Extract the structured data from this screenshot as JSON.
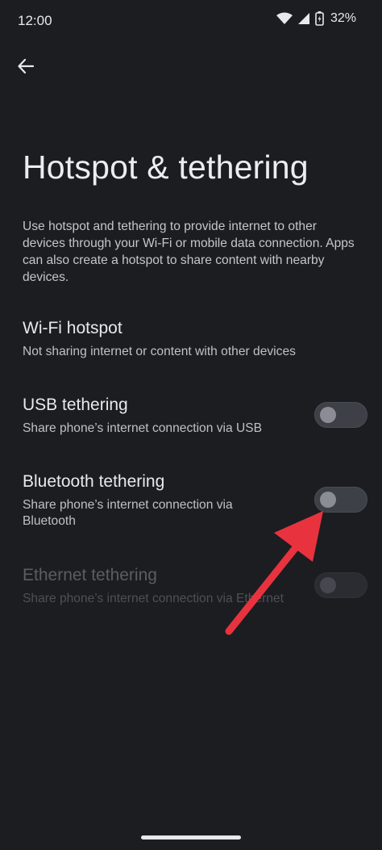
{
  "status_bar": {
    "time": "12:00",
    "battery": "32%",
    "icons": [
      "wifi-icon",
      "signal-icon",
      "battery-charging-icon"
    ]
  },
  "header": {
    "back_icon": "arrow-left-icon",
    "title": "Hotspot & tethering"
  },
  "intro": "Use hotspot and tethering to provide internet to other devices through your Wi-Fi or mobile data connection. Apps can also create a hotspot to share content with nearby devices.",
  "settings": [
    {
      "title": "Wi-Fi hotspot",
      "subtitle": "Not sharing internet or content with other devices"
    },
    {
      "title": "USB tethering",
      "subtitle": "Share phone’s internet connection via USB",
      "toggle": "off"
    },
    {
      "title": "Bluetooth tethering",
      "subtitle": "Share phone’s internet connection via Bluetooth",
      "toggle": "off"
    },
    {
      "title": "Ethernet tethering",
      "subtitle": "Share phone’s internet connection via Ethernet",
      "toggle": "off",
      "enabled": false
    }
  ],
  "colors": {
    "background": "#1b1d21",
    "annotation_arrow": "#e8333f"
  }
}
